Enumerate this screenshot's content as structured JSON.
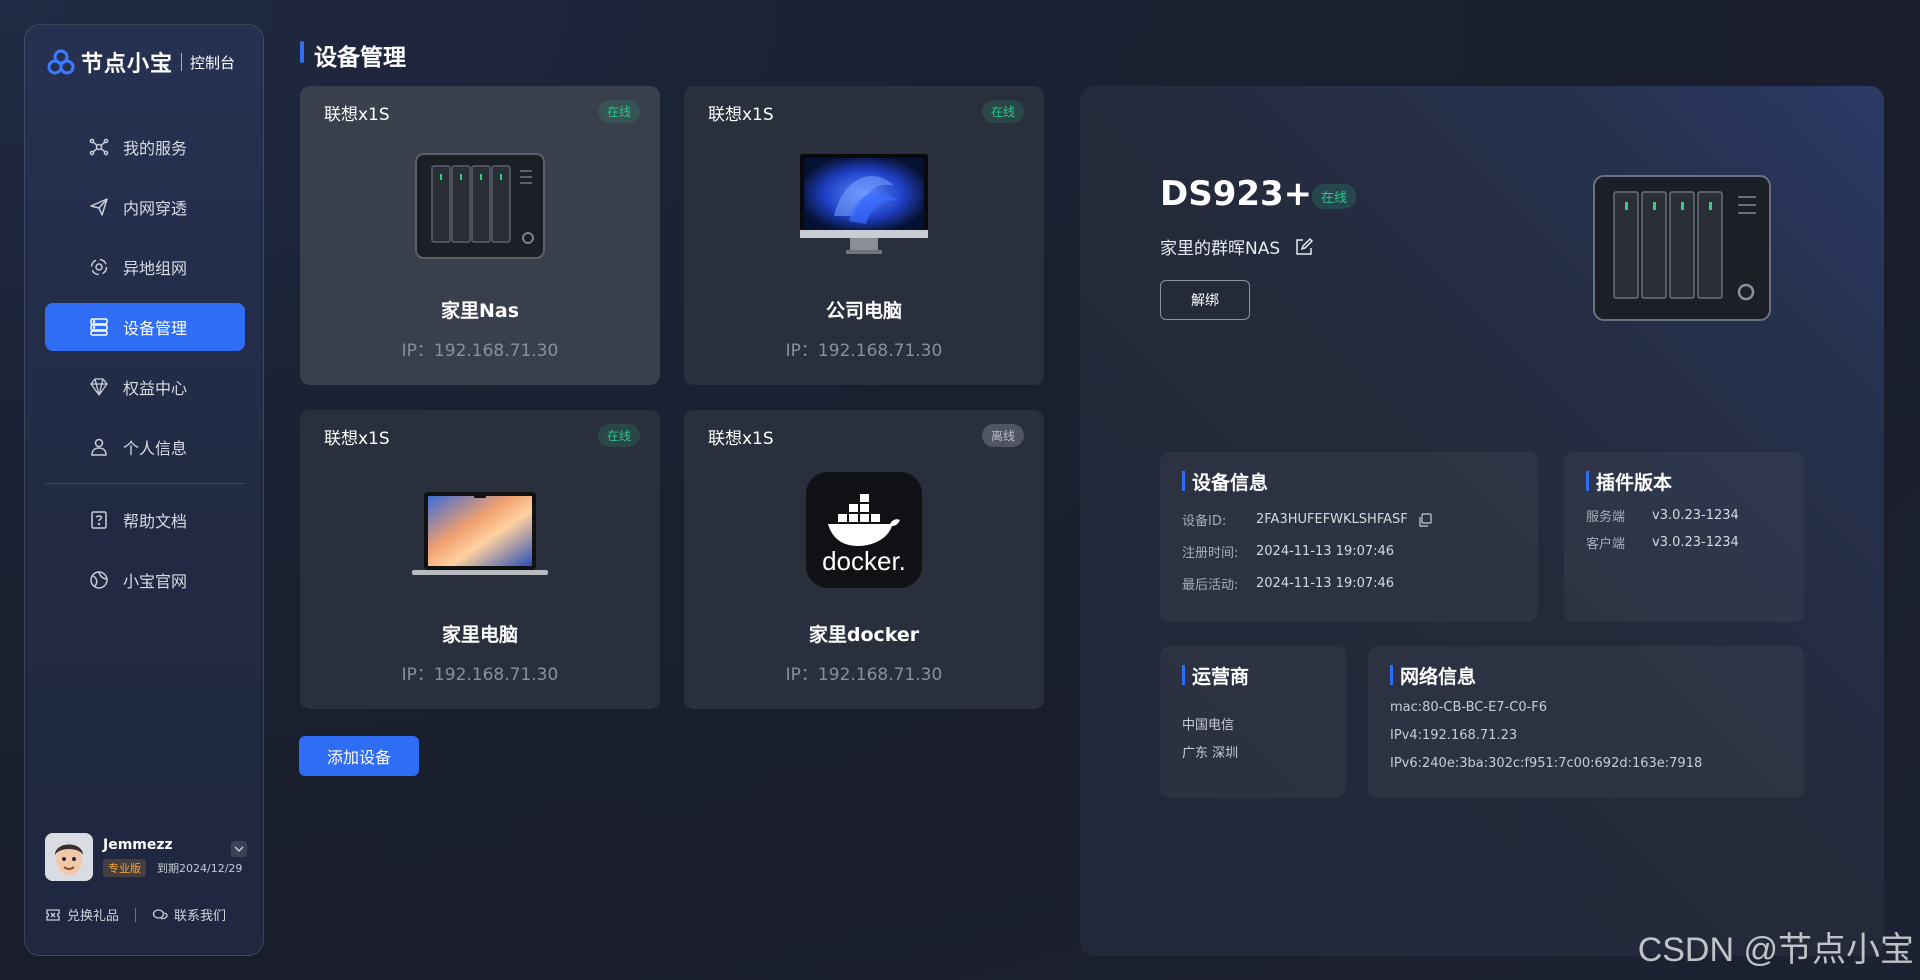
{
  "brand": {
    "name": "节点小宝",
    "sub": "控制台"
  },
  "nav": {
    "items": [
      {
        "label": "我的服务",
        "icon": "services-icon"
      },
      {
        "label": "内网穿透",
        "icon": "paper-plane-icon"
      },
      {
        "label": "异地组网",
        "icon": "network-icon"
      },
      {
        "label": "设备管理",
        "icon": "device-icon",
        "active": true
      },
      {
        "label": "权益中心",
        "icon": "diamond-icon"
      },
      {
        "label": "个人信息",
        "icon": "user-icon"
      }
    ],
    "secondary": [
      {
        "label": "帮助文档",
        "icon": "help-icon"
      },
      {
        "label": "小宝官网",
        "icon": "globe-icon"
      }
    ]
  },
  "user": {
    "name": "Jemmezz",
    "plan": "专业版",
    "expire": "到期2024/12/29",
    "links": {
      "gift": "兑换礼品",
      "contact": "联系我们"
    }
  },
  "page": {
    "title": "设备管理",
    "add_button": "添加设备"
  },
  "devices": [
    {
      "model": "联想x1S",
      "status": "在线",
      "name": "家里Nas",
      "ip": "IP：192.168.71.30",
      "image": "nas-icon"
    },
    {
      "model": "联想x1S",
      "status": "在线",
      "name": "公司电脑",
      "ip": "IP：192.168.71.30",
      "image": "desktop-icon"
    },
    {
      "model": "联想x1S",
      "status": "在线",
      "name": "家里电脑",
      "ip": "IP：192.168.71.30",
      "image": "laptop-icon"
    },
    {
      "model": "联想x1S",
      "status": "离线",
      "name": "家里docker",
      "ip": "IP：192.168.71.30",
      "image": "docker-icon"
    }
  ],
  "detail": {
    "title": "DS923+",
    "status": "在线",
    "subtitle": "家里的群晖NAS",
    "unbind": "解绑",
    "device_info": {
      "title": "设备信息",
      "id_label": "设备ID:",
      "id": "2FA3HUFEFWKLSHFASF",
      "reg_label": "注册时间:",
      "reg": "2024-11-13 19:07:46",
      "last_label": "最后活动:",
      "last": "2024-11-13 19:07:46"
    },
    "plugin": {
      "title": "插件版本",
      "server_label": "服务端",
      "server": "v3.0.23-1234",
      "client_label": "客户端",
      "client": "v3.0.23-1234"
    },
    "carrier": {
      "title": "运营商",
      "name": "中国电信",
      "location": "广东 深圳"
    },
    "network": {
      "title": "网络信息",
      "mac": "mac:80-CB-BC-E7-C0-F6",
      "ipv4": "IPv4:192.168.71.23",
      "ipv6": "IPv6:240e:3ba:302c:f951:7c00:692d:163e:7918"
    }
  },
  "watermark": "CSDN @节点小宝",
  "colors": {
    "accent": "#2f6df5",
    "online": "#2fc38a",
    "plan": "#f0a43a"
  }
}
